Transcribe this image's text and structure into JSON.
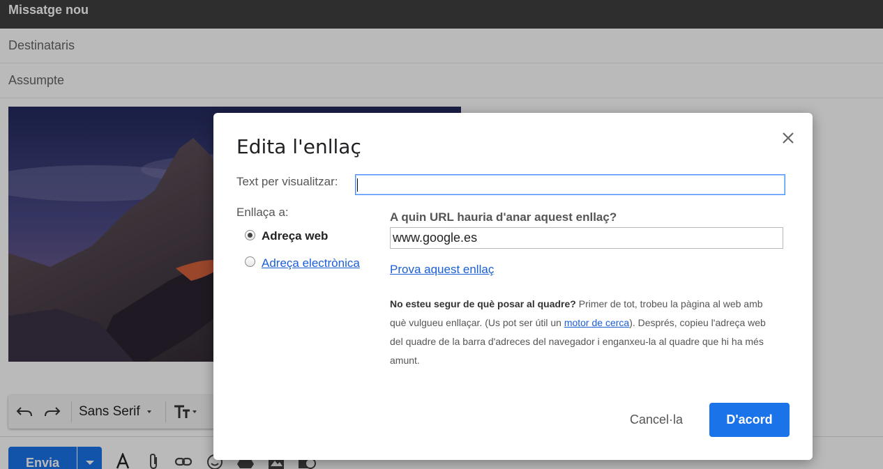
{
  "compose": {
    "window_title": "Missatge nou",
    "recipients_placeholder": "Destinataris",
    "subject_placeholder": "Assumpte",
    "toolbar": {
      "font_name": "Sans Serif"
    },
    "send_label": "Envia"
  },
  "dialog": {
    "title": "Edita l'enllaç",
    "display_text_label": "Text per visualitzar:",
    "display_text_value": "",
    "link_to_label": "Enllaça a:",
    "link_types": [
      {
        "label": "Adreça web",
        "selected": true
      },
      {
        "label": "Adreça electrònica",
        "selected": false
      }
    ],
    "url_question": "A quin URL hauria d'anar aquest enllaç?",
    "url_value": "www.google.es",
    "test_link": "Prova aquest enllaç",
    "help": {
      "bold_intro": "No esteu segur de què posar al quadre?",
      "text_before_link": " Primer de tot, trobeu la pàgina al web amb què vulgueu enllaçar. (Us pot ser útil un ",
      "link_text": "motor de cerca",
      "text_after_link": "). Després, copieu l'adreça web del quadre de la barra d'adreces del navegador i enganxeu-la al quadre que hi ha més amunt."
    },
    "cancel_label": "Cancel·la",
    "ok_label": "D'acord"
  },
  "colors": {
    "primary_button": "#1a73e8",
    "link": "#1a5ed6",
    "header_bar": "#404040"
  },
  "icons": [
    "undo-icon",
    "redo-icon",
    "font-dropdown-icon",
    "text-size-icon",
    "close-icon",
    "formatting-icon",
    "attach-icon",
    "link-icon",
    "emoji-icon",
    "drive-icon",
    "photo-icon",
    "schedule-icon"
  ]
}
